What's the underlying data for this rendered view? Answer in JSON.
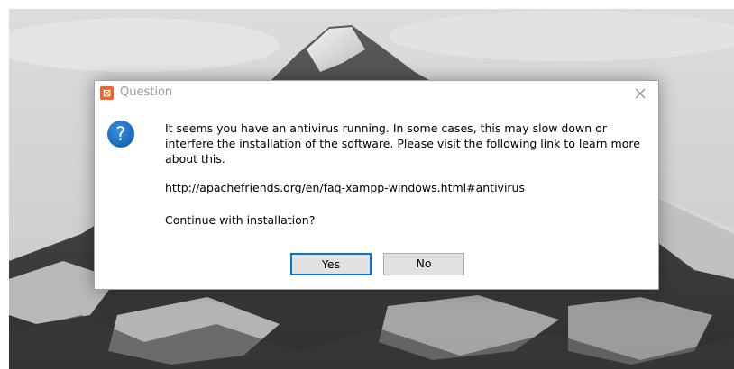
{
  "dialog": {
    "title": "Question",
    "app_icon_glyph": "⊠",
    "icon": "question-icon",
    "message": "It seems you have an antivirus running. In some cases, this may slow down or interfere the installation of the software. Please visit the following link to learn more about this.",
    "link": "http://apachefriends.org/en/faq-xampp-windows.html#antivirus",
    "prompt": "Continue with installation?",
    "buttons": {
      "yes_label": "Yes",
      "no_label": "No"
    }
  },
  "colors": {
    "app_icon": "#f0642a",
    "question_icon": "#1f6fc3",
    "default_button_border": "#0078d7",
    "button_face": "#e1e1e1"
  }
}
